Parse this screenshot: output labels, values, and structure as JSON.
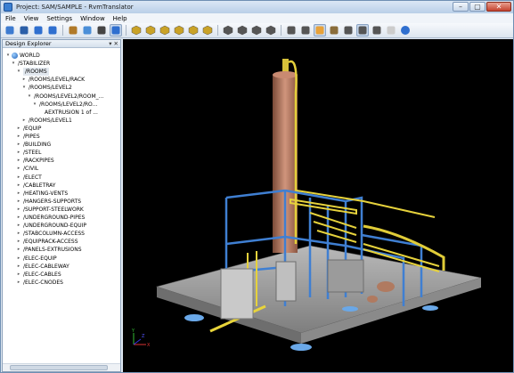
{
  "window": {
    "title": "Project: SAM/SAMPLE - RvmTranslator",
    "buttons": [
      "–",
      "▢",
      "✕"
    ]
  },
  "menu": [
    "File",
    "View",
    "Settings",
    "Window",
    "Help"
  ],
  "toolbar": {
    "icons": [
      "open-icon",
      "save-icon",
      "add-icon",
      "remove-icon",
      "edit-icon",
      "satellite-icon",
      "search-icon",
      "orbit-icon",
      "cube-view-1-icon",
      "cube-view-2-icon",
      "cube-view-3-icon",
      "cube-view-4-icon",
      "cube-view-5-icon",
      "cube-view-6-icon",
      "iso-view-1-icon",
      "iso-view-2-icon",
      "iso-view-3-icon",
      "iso-view-4-icon",
      "zoom-icon",
      "fit-icon",
      "shaded-icon",
      "clip-box-icon",
      "measure-icon",
      "select-icon",
      "wireframe-icon",
      "blank-icon",
      "help-icon"
    ]
  },
  "explorer": {
    "title": "Design Explorer",
    "header_buttons": "▾ ✕",
    "tree": [
      {
        "label": "WORLD",
        "expand": "▾",
        "indent": 0,
        "icon": "globe"
      },
      {
        "label": "/STABILIZER",
        "expand": "▾",
        "indent": 1
      },
      {
        "label": "/ROOMS",
        "expand": "▾",
        "indent": 2,
        "selected": true
      },
      {
        "label": "/ROOMS/LEVEL/RACK",
        "expand": "▸",
        "indent": 3
      },
      {
        "label": "/ROOMS/LEVEL2",
        "expand": "▾",
        "indent": 3
      },
      {
        "label": "/ROOMS/LEVEL2/ROOM_...",
        "expand": "▾",
        "indent": 4
      },
      {
        "label": "/ROOMS/LEVEL2/RO...",
        "expand": "▾",
        "indent": 5
      },
      {
        "label": "AEXTRUSION 1 of ...",
        "expand": "",
        "indent": 6
      },
      {
        "label": "/ROOMS/LEVEL1",
        "expand": "▸",
        "indent": 3
      },
      {
        "label": "/EQUIP",
        "expand": "▸",
        "indent": 2
      },
      {
        "label": "/PIPES",
        "expand": "▸",
        "indent": 2
      },
      {
        "label": "/BUILDING",
        "expand": "▸",
        "indent": 2
      },
      {
        "label": "/STEEL",
        "expand": "▸",
        "indent": 2
      },
      {
        "label": "/RACKPIPES",
        "expand": "▸",
        "indent": 2
      },
      {
        "label": "/CIVIL",
        "expand": "▸",
        "indent": 2
      },
      {
        "label": "/ELECT",
        "expand": "▸",
        "indent": 2
      },
      {
        "label": "/CABLETRAY",
        "expand": "▸",
        "indent": 2
      },
      {
        "label": "/HEATING-VENTS",
        "expand": "▸",
        "indent": 2
      },
      {
        "label": "/HANGERS-SUPPORTS",
        "expand": "▸",
        "indent": 2
      },
      {
        "label": "/SUPPORT-STEELWORK",
        "expand": "▸",
        "indent": 2
      },
      {
        "label": "/UNDERGROUND-PIPES",
        "expand": "▸",
        "indent": 2
      },
      {
        "label": "/UNDERGROUND-EQUIP",
        "expand": "▸",
        "indent": 2
      },
      {
        "label": "/STABCOLUMN-ACCESS",
        "expand": "▸",
        "indent": 2
      },
      {
        "label": "/EQUIPRACK-ACCESS",
        "expand": "▸",
        "indent": 2
      },
      {
        "label": "/PANELS-EXTRUSIONS",
        "expand": "▸",
        "indent": 2
      },
      {
        "label": "/ELEC-EQUIP",
        "expand": "▸",
        "indent": 2
      },
      {
        "label": "/ELEC-CABLEWAY",
        "expand": "▸",
        "indent": 2
      },
      {
        "label": "/ELEC-CABLES",
        "expand": "▸",
        "indent": 2
      },
      {
        "label": "/ELEC-CNODES",
        "expand": "▸",
        "indent": 2
      }
    ]
  },
  "viewport": {
    "name": "3d-plant-model",
    "background": "#000000",
    "axis_labels": [
      "X",
      "Y",
      "Z"
    ]
  }
}
